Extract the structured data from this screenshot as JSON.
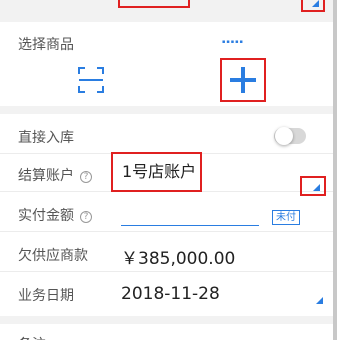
{
  "product": {
    "title": "选择商品",
    "tiny_text": "▪▪▪▪▪"
  },
  "form": {
    "direct_stock_label": "直接入库",
    "direct_stock_on": false,
    "settle_account_label": "结算账户",
    "settle_account_value": "1号店账户",
    "paid_amount_label": "实付金额",
    "paid_amount_value": "",
    "unpaid_tag": "未付",
    "payable_label": "欠供应商款",
    "payable_value": "￥385,000.00",
    "date_label": "业务日期",
    "date_value": "2018-11-28"
  },
  "remark": {
    "label": "备注"
  },
  "colors": {
    "accent": "#2a7de1",
    "highlight": "#e02020"
  },
  "icons": {
    "scan": "scan-icon",
    "add": "plus-icon",
    "help": "question-circle-icon",
    "dropdown": "triangle-corner-icon"
  }
}
